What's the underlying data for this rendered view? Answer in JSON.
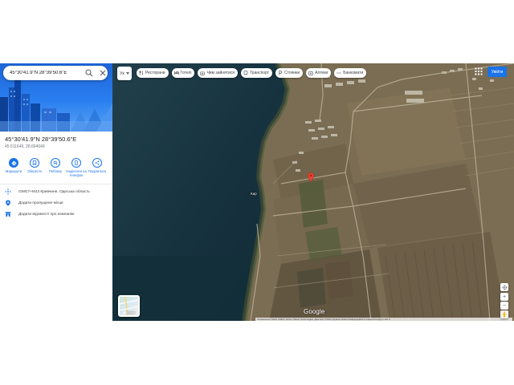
{
  "search": {
    "value": "45°30'41.9\"N 28°39'50.6\"E",
    "placeholder": "Пошук у Картах Google"
  },
  "place": {
    "title": "45°30'41.9\"N 28°39'50.6\"E",
    "decimal": "45.511649, 28.664049"
  },
  "actions": [
    {
      "label": "Маршрути",
      "icon": "directions-icon"
    },
    {
      "label": "Зберегти",
      "icon": "bookmark-icon"
    },
    {
      "label": "Поблизу",
      "icon": "nearby-icon"
    },
    {
      "label": "Надіслати на телефон",
      "icon": "send-to-phone-icon"
    },
    {
      "label": "Поділитися",
      "icon": "share-icon"
    }
  ],
  "info": {
    "plus_code": "GMG7+MJ3 Кривчине, Одеська область",
    "add_place": "Додати пропущене місце",
    "add_business": "Додати відомості про компанію"
  },
  "map": {
    "layer_label": "Ук",
    "chips": [
      {
        "label": "Ресторани",
        "icon": "restaurant-icon"
      },
      {
        "label": "Готелі",
        "icon": "hotel-icon"
      },
      {
        "label": "Чим зайнятися",
        "icon": "activities-icon"
      },
      {
        "label": "Транспорт",
        "icon": "transit-icon"
      },
      {
        "label": "Стоянки",
        "icon": "parking-icon"
      },
      {
        "label": "Аптеки",
        "icon": "pharmacy-icon"
      },
      {
        "label": "Банкомати",
        "icon": "atm-icon"
      }
    ],
    "place_label": "Кир",
    "layers_label": "Шари",
    "signin_label": "Увійти",
    "logo": "Google",
    "attribution": "Зображення ©2024 CNES / Airbus, Maxar Technologies, Дані карт ©2024  Україна  Умови  Конфіденційність  Надіслати відгук  200 м",
    "zoom_in": "+",
    "zoom_out": "−",
    "colors": {
      "water": "#16303c",
      "land": "#7d6f55",
      "pin": "#ea4335",
      "accent": "#1a73e8"
    }
  }
}
